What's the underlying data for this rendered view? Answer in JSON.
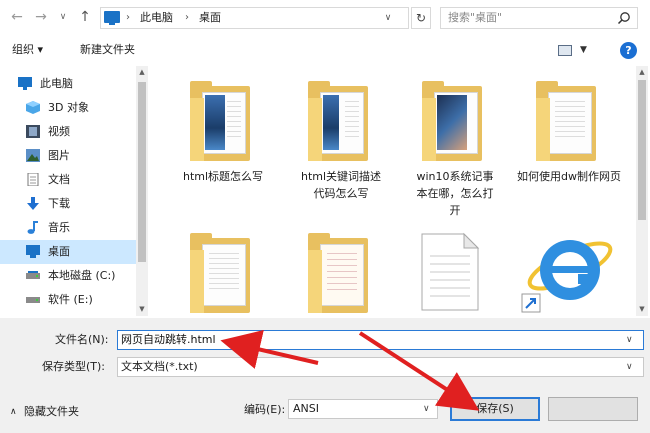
{
  "nav": {
    "back": "←",
    "forward": "→",
    "dropdown": "∨",
    "up": "↑",
    "breadcrumb": [
      "此电脑",
      "桌面"
    ],
    "refresh": "↻",
    "search_placeholder": "搜索\"桌面\""
  },
  "toolbar": {
    "organize": "组织 ▾",
    "new_folder": "新建文件夹",
    "view_dd": "▼",
    "help": "?"
  },
  "sidebar": {
    "items": [
      {
        "label": "此电脑",
        "icon": "computer-icon",
        "root": true
      },
      {
        "label": "3D 对象",
        "icon": "3d-objects-icon"
      },
      {
        "label": "视频",
        "icon": "video-icon"
      },
      {
        "label": "图片",
        "icon": "pictures-icon"
      },
      {
        "label": "文档",
        "icon": "documents-icon"
      },
      {
        "label": "下载",
        "icon": "download-icon"
      },
      {
        "label": "音乐",
        "icon": "music-icon"
      },
      {
        "label": "桌面",
        "icon": "desktop-icon",
        "selected": true
      },
      {
        "label": "本地磁盘 (C:)",
        "icon": "drive-icon"
      },
      {
        "label": "软件 (E:)",
        "icon": "drive-icon"
      }
    ]
  },
  "files": [
    {
      "label": "html标题怎么写"
    },
    {
      "label": "html关键词描述代码怎么写"
    },
    {
      "label": "win10系统记事本在哪，怎么打开"
    },
    {
      "label": "如何使用dw制作网页"
    }
  ],
  "bottom": {
    "filename_label": "文件名(N):",
    "filename_value": "网页自动跳转.html",
    "type_label": "保存类型(T):",
    "type_value": "文本文档(*.txt)",
    "hide_folders": "隐藏文件夹",
    "encoding_label": "编码(E):",
    "encoding_value": "ANSI",
    "save": "保存(S)"
  },
  "colors": {
    "accent": "#2a7ad6",
    "selection": "#cce8ff",
    "folder": "#e8c060",
    "annotation_arrow": "#e02020"
  }
}
